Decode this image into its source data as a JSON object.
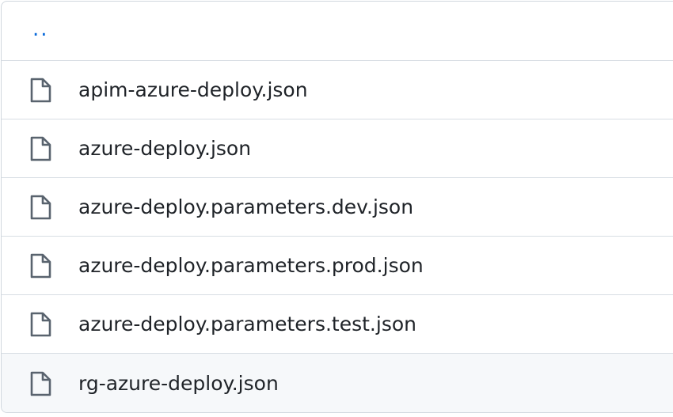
{
  "parent_dir": {
    "label": ".."
  },
  "files": [
    {
      "name": "apim-azure-deploy.json",
      "icon": "file-icon"
    },
    {
      "name": "azure-deploy.json",
      "icon": "file-icon"
    },
    {
      "name": "azure-deploy.parameters.dev.json",
      "icon": "file-icon"
    },
    {
      "name": "azure-deploy.parameters.prod.json",
      "icon": "file-icon"
    },
    {
      "name": "azure-deploy.parameters.test.json",
      "icon": "file-icon"
    },
    {
      "name": "rg-azure-deploy.json",
      "icon": "file-icon"
    }
  ],
  "colors": {
    "link": "#0969da",
    "text": "#1f2328",
    "icon": "#59636e",
    "border": "#d0d7de",
    "hover_row_bg": "#f6f8fa"
  }
}
